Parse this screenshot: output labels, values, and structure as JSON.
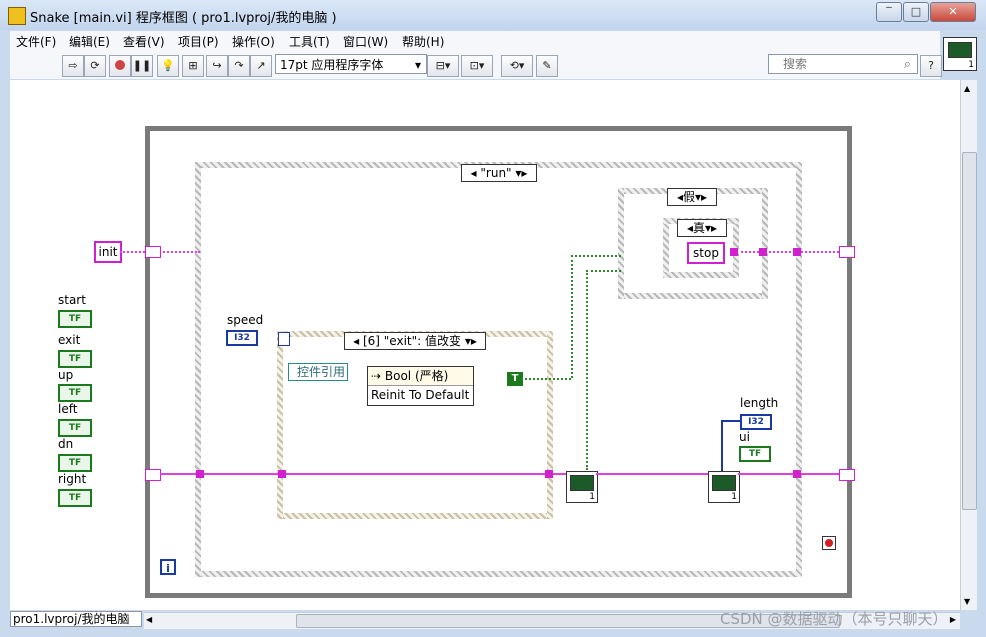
{
  "window": {
    "title": "Snake [main.vi] 程序框图 ( pro1.lvproj/我的电脑 )",
    "buttons": [
      "‾",
      "□",
      "✕"
    ]
  },
  "menu": [
    "文件(F)",
    "编辑(E)",
    "查看(V)",
    "项目(P)",
    "操作(O)",
    "工具(T)",
    "窗口(W)",
    "帮助(H)"
  ],
  "toolbar": {
    "font": "17pt 应用程序字体",
    "search_placeholder": "搜索",
    "help": "?"
  },
  "diagram": {
    "controls": {
      "init": "init",
      "speed": "speed",
      "i32": "I32",
      "start": "start",
      "exit": "exit",
      "up": "up",
      "left": "left",
      "dn": "dn",
      "right": "right",
      "tf": "TF",
      "length": "length",
      "ui": "ui",
      "tf2": "TF",
      "i32b": "I32",
      "stop": "stop",
      "t_const": "T",
      "iter": "i",
      "one": "1"
    },
    "case_run": "\"run\"",
    "case_false": "假",
    "case_true": "真",
    "event_case": "[6] \"exit\": 值改变",
    "ctrl_ref": "控件引用",
    "bool_node": "Bool (严格)",
    "reinit": "Reinit To Default"
  },
  "status": {
    "path": "pro1.lvproj/我的电脑"
  },
  "watermark": "CSDN @数据驱动（本号只聊天）",
  "colors": {
    "wire_string": "#e040e0",
    "wire_bool": "#2a8a2a",
    "wire_int": "#1a3aa0",
    "frame": "#7a7a7a"
  }
}
